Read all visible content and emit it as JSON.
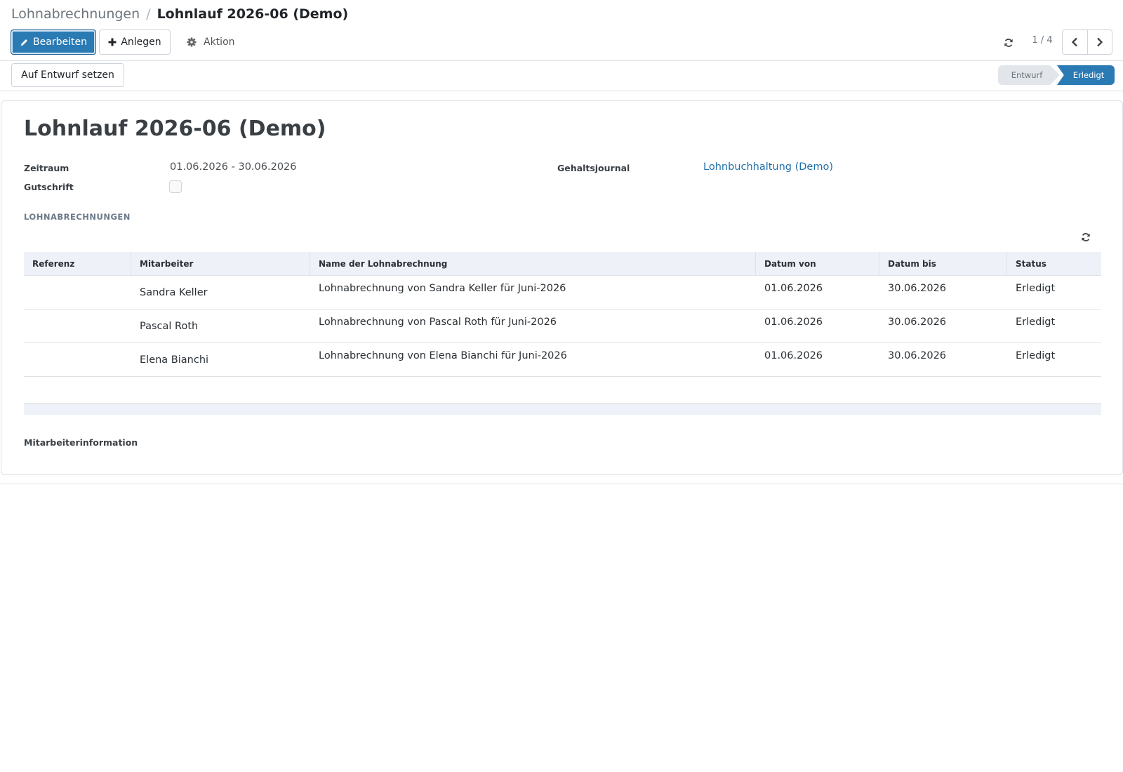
{
  "breadcrumb": {
    "parent": "Lohnabrechnungen",
    "separator": "/",
    "current": "Lohnlauf 2026-06 (Demo)"
  },
  "toolbar": {
    "edit_label": "Bearbeiten",
    "create_label": "Anlegen",
    "action_label": "Aktion"
  },
  "pager": {
    "value": "1 / 4"
  },
  "statusbar": {
    "draft_button_label": "Auf Entwurf setzen",
    "steps": [
      {
        "label": "Entwurf",
        "active": false
      },
      {
        "label": "Erledigt",
        "active": true
      }
    ]
  },
  "form": {
    "title": "Lohnlauf 2026-06 (Demo)",
    "period_label": "Zeitraum",
    "period_value": "01.06.2026 - 30.06.2026",
    "credit_label": "Gutschrift",
    "credit_checked": false,
    "journal_label": "Gehaltsjournal",
    "journal_value": "Lohnbuchhaltung (Demo)",
    "section_title": "LOHNABRECHNUNGEN",
    "employee_info_label": "Mitarbeiterinformation"
  },
  "table": {
    "columns": [
      "Referenz",
      "Mitarbeiter",
      "Name der Lohnabrechnung",
      "Datum von",
      "Datum bis",
      "Status"
    ],
    "rows": [
      {
        "reference": "",
        "employee": "Sandra Keller",
        "name": "Lohnabrechnung von Sandra Keller für Juni-2026",
        "date_from": "01.06.2026",
        "date_to": "30.06.2026",
        "status": "Erledigt"
      },
      {
        "reference": "",
        "employee": "Pascal Roth",
        "name": "Lohnabrechnung von Pascal Roth für Juni-2026",
        "date_from": "01.06.2026",
        "date_to": "30.06.2026",
        "status": "Erledigt"
      },
      {
        "reference": "",
        "employee": "Elena Bianchi",
        "name": "Lohnabrechnung von Elena Bianchi für Juni-2026",
        "date_from": "01.06.2026",
        "date_to": "30.06.2026",
        "status": "Erledigt"
      }
    ]
  },
  "icons": {
    "edit": "pencil-icon",
    "create": "plus-icon",
    "action": "gear-icon",
    "refresh": "refresh-icon",
    "previous": "chevron-left-icon",
    "next": "chevron-right-icon"
  },
  "colors": {
    "primary": "#2a7ab4",
    "link": "#1f6fa8",
    "header_background": "#eef2f8",
    "inactive_step": "#e2e6ea"
  }
}
